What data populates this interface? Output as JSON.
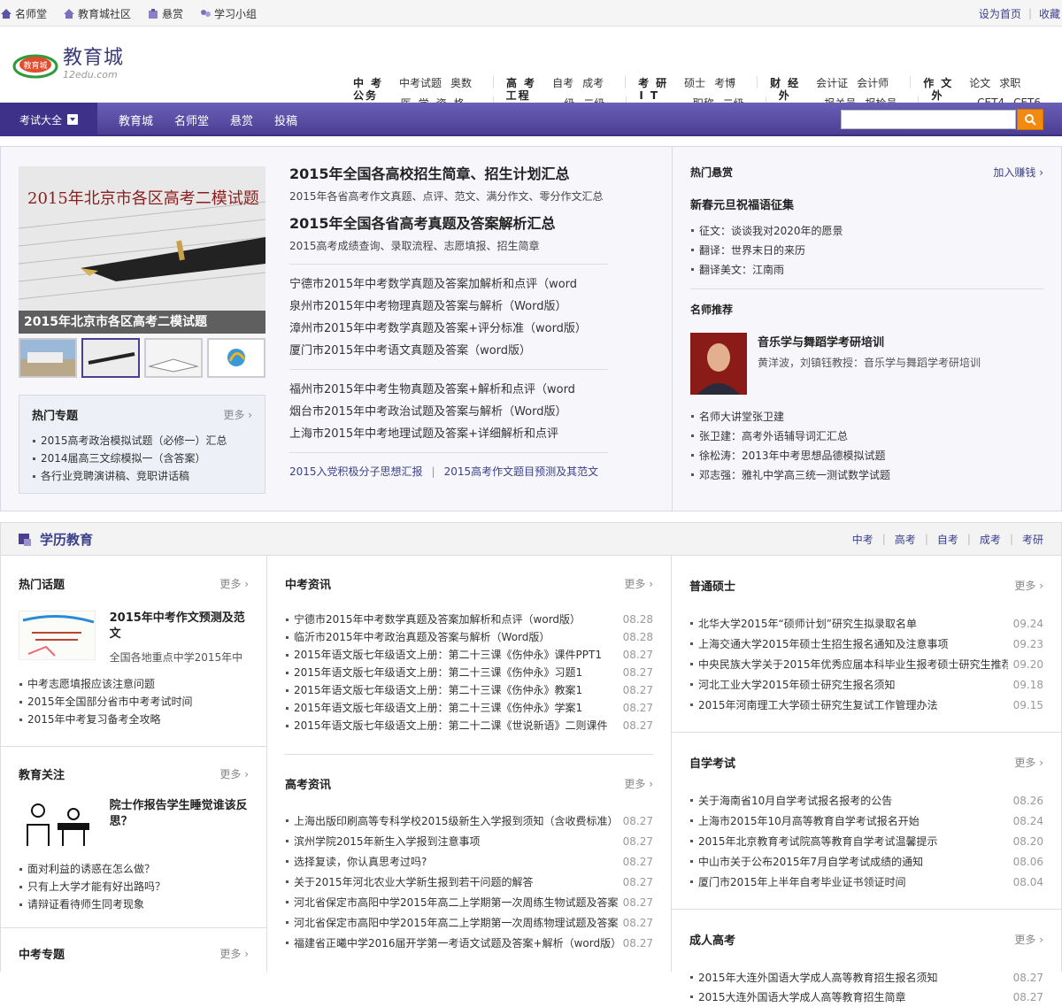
{
  "topbar": {
    "links": [
      "名师堂",
      "教育城社区",
      "悬赏",
      "学习小组"
    ],
    "right": [
      "设为首页",
      "收藏"
    ]
  },
  "logo": {
    "cn": "教育城",
    "en": "12edu.com",
    "mark": "教育城"
  },
  "cats": {
    "row1": [
      {
        "h": "中考",
        "s": [
          "中考试题",
          "奥数"
        ]
      },
      {
        "h": "高考",
        "s": [
          "自考",
          "成考"
        ]
      },
      {
        "h": "考研",
        "s": [
          "硕士",
          "考博"
        ]
      },
      {
        "h": "财经",
        "s": [
          "会计证",
          "会计师"
        ]
      },
      {
        "h": "作文",
        "s": [
          "论文",
          "求职"
        ]
      }
    ],
    "row2": [
      {
        "h": "公务员",
        "s": [
          "医学资格"
        ]
      },
      {
        "h": "工程类",
        "s": [
          "一级",
          "二级"
        ]
      },
      {
        "h": "IT类",
        "s": [
          "职称",
          "二级"
        ]
      },
      {
        "h": "外贸",
        "s": [
          "报关员",
          "报检员"
        ]
      },
      {
        "h": "外语",
        "s": [
          "CET4",
          "CET6"
        ]
      }
    ]
  },
  "nav": {
    "exam": "考试大全",
    "links": [
      "教育城",
      "名师堂",
      "悬赏",
      "投稿"
    ],
    "search_placeholder": ""
  },
  "hero": {
    "slide_title": "2015年北京市各区高考二模试题",
    "slide_caption": "2015年北京市各区高考二模试题",
    "hot_topic": {
      "title": "热门专题",
      "more": "更多",
      "items": [
        "2015高考政治模拟试题（必修一）汇总",
        "2014届高三文综模拟一（含答案）",
        "各行业竞聘演讲稿、竞职讲话稿"
      ]
    },
    "mid": {
      "h1": "2015年全国各高校招生简章、招生计划汇总",
      "s1": "2015年各省高考作文真题、点评、范文、满分作文、零分作文汇总",
      "h2": "2015年全国各省高考真题及答案解析汇总",
      "s2": "2015高考成绩查询、录取流程、志愿填报、招生简章",
      "list1": [
        "宁德市2015年中考数学真题及答案加解析和点评（word",
        "泉州市2015年中考物理真题及答案与解析（Word版）",
        "漳州市2015年中考数学真题及答案+评分标准（word版）",
        "厦门市2015年中考语文真题及答案（word版）"
      ],
      "list2": [
        "福州市2015年中考生物真题及答案+解析和点评（word",
        "烟台市2015年中考政治试题及答案与解析（Word版）",
        "上海市2015年中考地理试题及答案+详细解析和点评"
      ],
      "foot": [
        "2015入党积极分子思想汇报",
        "2015高考作文题目预测及其范文"
      ]
    },
    "right": {
      "title": "热门悬赏",
      "more": "加入赚钱",
      "bold": "新春元旦祝福语征集",
      "items": [
        "征文：谈谈我对2020年的愿景",
        "翻译：世界末日的来历",
        "翻译美文：江南雨"
      ],
      "rec_title": "名师推荐",
      "teacher": {
        "name": "音乐学与舞蹈学考研培训",
        "desc": "黄洋波，刘镇钰教授：音乐学与舞蹈学考研培训"
      },
      "rec_items": [
        "名师大讲堂张卫建",
        "张卫建：高考外语辅导词汇汇总",
        "徐松涛：2013年中考思想品德模拟试题",
        "邓志强：雅礼中学高三统一测试数学试题"
      ]
    }
  },
  "edu": {
    "title": "学历教育",
    "tabs": [
      "中考",
      "高考",
      "自考",
      "成考",
      "考研"
    ]
  },
  "col1": {
    "b1": {
      "title": "热门话题",
      "more": "更多",
      "feat": {
        "n": "2015年中考作文预测及范文",
        "d": "全国各地重点中学2015年中"
      },
      "items": [
        "中考志愿填报应该注意问题",
        "2015年全国部分省市中考考试时间",
        "2015年中考复习备考全攻略"
      ]
    },
    "b2": {
      "title": "教育关注",
      "more": "更多",
      "feat": {
        "n": "院士作报告学生睡觉谁该反思？",
        "d": ""
      },
      "items": [
        "面对利益的诱惑在怎么做？",
        "只有上大学才能有好出路吗？",
        "请辩证看待师生同考现象"
      ]
    },
    "b3": {
      "title": "中考专题",
      "more": "更多"
    }
  },
  "col2": {
    "b1": {
      "title": "中考资讯",
      "more": "更多",
      "items": [
        {
          "t": "宁德市2015年中考数学真题及答案加解析和点评（word版）",
          "d": "08.28"
        },
        {
          "t": "临沂市2015年中考政治真题及答案与解析（Word版）",
          "d": "08.28"
        },
        {
          "t": "2015年语文版七年级语文上册：第二十三课《伤仲永》课件PPT1",
          "d": "08.27"
        },
        {
          "t": "2015年语文版七年级语文上册：第二十三课《伤仲永》习题1",
          "d": "08.27"
        },
        {
          "t": "2015年语文版七年级语文上册：第二十三课《伤仲永》教案1",
          "d": "08.27"
        },
        {
          "t": "2015年语文版七年级语文上册：第二十三课《伤仲永》学案1",
          "d": "08.27"
        },
        {
          "t": "2015年语文版七年级语文上册：第二十二课《世说新语》二则课件",
          "d": "08.27"
        }
      ]
    },
    "b2": {
      "title": "高考资讯",
      "more": "更多",
      "items": [
        {
          "t": "上海出版印刷高等专科学校2015级新生入学报到须知（含收费标准）",
          "d": "08.27"
        },
        {
          "t": "滨州学院2015年新生入学报到注意事项",
          "d": "08.27"
        },
        {
          "t": "选择复读，你认真思考过吗?",
          "d": "08.27"
        },
        {
          "t": "关于2015年河北农业大学新生报到若干问题的解答",
          "d": "08.27"
        },
        {
          "t": "河北省保定市高阳中学2015年高二上学期第一次周练生物试题及答案",
          "d": "08.27"
        },
        {
          "t": "河北省保定市高阳中学2015年高二上学期第一次周练物理试题及答案",
          "d": "08.27"
        },
        {
          "t": "福建省正曦中学2016届开学第一考语文试题及答案+解析（word版）",
          "d": "08.27"
        }
      ]
    }
  },
  "col3": {
    "b1": {
      "title": "普通硕士",
      "more": "更多",
      "items": [
        {
          "t": "北华大学2015年“硕师计划”研究生拟录取名单",
          "d": "09.24"
        },
        {
          "t": "上海交通大学2015年硕士生招生报名通知及注意事项",
          "d": "09.23"
        },
        {
          "t": "中央民族大学关于2015年优秀应届本科毕业生报考硕士研究生推荐",
          "d": "09.20"
        },
        {
          "t": "河北工业大学2015年硕士研究生报名须知",
          "d": "09.18"
        },
        {
          "t": "2015年河南理工大学硕士研究生复试工作管理办法",
          "d": "09.15"
        }
      ]
    },
    "b2": {
      "title": "自学考试",
      "more": "更多",
      "items": [
        {
          "t": "关于海南省10月自学考试报名报考的公告",
          "d": "08.26"
        },
        {
          "t": "上海市2015年10月高等教育自学考试报名开始",
          "d": "08.24"
        },
        {
          "t": "2015年北京教育考试院高等教育自学考试温馨提示",
          "d": "08.20"
        },
        {
          "t": "中山市关于公布2015年7月自学考试成绩的通知",
          "d": "08.06"
        },
        {
          "t": "厦门市2015年上半年自考毕业证书领证时间",
          "d": "08.04"
        }
      ]
    },
    "b3": {
      "title": "成人高考",
      "more": "更多",
      "items": [
        {
          "t": "2015年大连外国语大学成人高等教育招生报名须知",
          "d": "08.27"
        },
        {
          "t": "2015大连外国语大学成人高等教育招生简章",
          "d": "08.27"
        }
      ]
    }
  },
  "colors": {
    "nav": "#4b3e93",
    "accent": "#3a3f8a",
    "search_btn": "#f08a10"
  }
}
